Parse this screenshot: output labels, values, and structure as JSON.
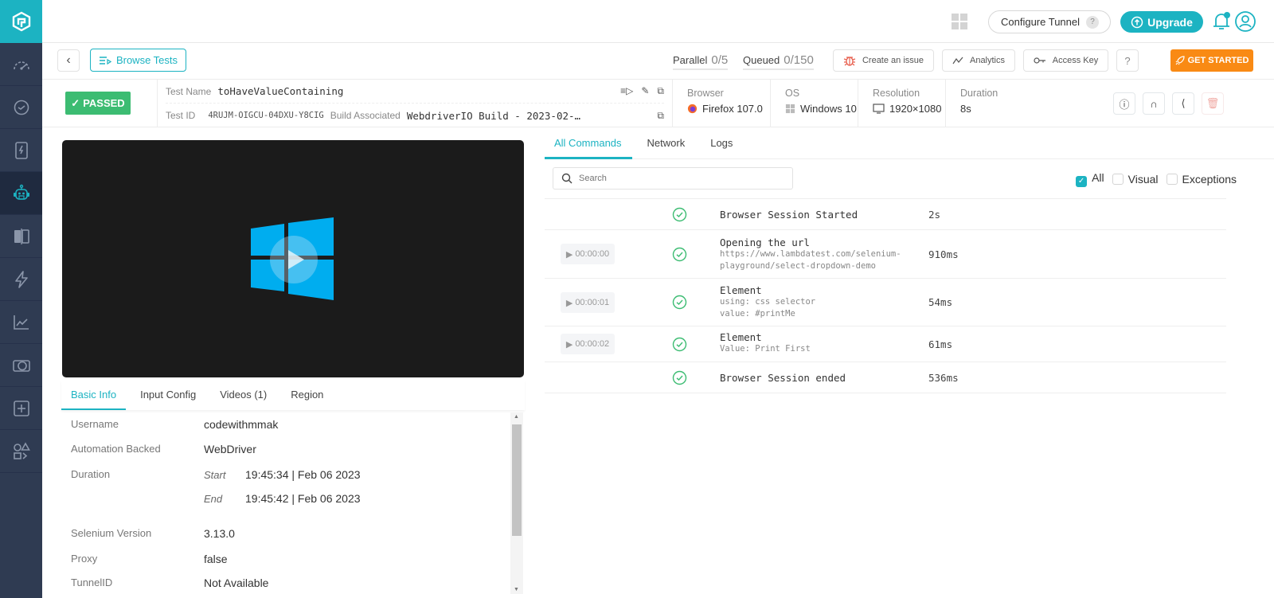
{
  "sidebar": {
    "items": [
      {
        "name": "dashboard",
        "active": false
      },
      {
        "name": "realtime-testing",
        "active": false
      },
      {
        "name": "app-testing",
        "active": false
      },
      {
        "name": "automation",
        "active": true
      },
      {
        "name": "visual-testing",
        "active": false
      },
      {
        "name": "hyperexecute",
        "active": false
      },
      {
        "name": "analytics",
        "active": false
      },
      {
        "name": "test-manager",
        "active": false
      },
      {
        "name": "add-integration",
        "active": false
      },
      {
        "name": "more-apps",
        "active": false
      }
    ]
  },
  "topbar": {
    "configure_tunnel": "Configure Tunnel",
    "help_badge": "?",
    "upgrade": "Upgrade"
  },
  "subbar": {
    "browse_tests": "Browse Tests",
    "parallel_label": "Parallel",
    "parallel_value": "0/5",
    "queued_label": "Queued",
    "queued_value": "0/150",
    "create_issue": "Create an issue",
    "analytics": "Analytics",
    "access_key": "Access Key",
    "help": "?",
    "get_started": "GET STARTED"
  },
  "test": {
    "status": "PASSED",
    "name_label": "Test Name",
    "name": "toHaveValueContaining",
    "id_label": "Test ID",
    "id": "4RUJM-OIGCU-04DXU-Y8CIG",
    "build_label": "Build Associated",
    "build": "WebdriverIO Build - 2023-02-…",
    "browser_label": "Browser",
    "browser": "Firefox 107.0",
    "os_label": "OS",
    "os": "Windows 10",
    "resolution_label": "Resolution",
    "resolution": "1920×1080",
    "duration_label": "Duration",
    "duration": "8s"
  },
  "info_tabs": [
    {
      "label": "Basic Info",
      "active": true
    },
    {
      "label": "Input Config",
      "active": false
    },
    {
      "label": "Videos (1)",
      "active": false
    },
    {
      "label": "Region",
      "active": false
    }
  ],
  "basic_info": {
    "username_label": "Username",
    "username": "codewithmmak",
    "automation_label": "Automation Backed",
    "automation": "WebDriver",
    "duration_label": "Duration",
    "start_label": "Start",
    "start_time": "19:45:34",
    "start_date": "Feb 06 2023",
    "end_label": "End",
    "end_time": "19:45:42",
    "end_date": "Feb 06 2023",
    "selenium_label": "Selenium Version",
    "selenium": "3.13.0",
    "proxy_label": "Proxy",
    "proxy": "false",
    "tunnel_label": "TunnelID",
    "tunnel": "Not Available"
  },
  "command_tabs": [
    {
      "label": "All Commands",
      "active": true
    },
    {
      "label": "Network",
      "active": false
    },
    {
      "label": "Logs",
      "active": false
    }
  ],
  "search": {
    "placeholder": "Search"
  },
  "filters": [
    {
      "label": "All",
      "checked": true
    },
    {
      "label": "Visual",
      "checked": false
    },
    {
      "label": "Exceptions",
      "checked": false
    }
  ],
  "commands": [
    {
      "timestamp": "",
      "name": "Browser Session Started",
      "details": [],
      "duration": "2s"
    },
    {
      "timestamp": "00:00:00",
      "name": "Opening the url",
      "details": [
        "https://www.lambdatest.com/selenium-",
        "playground/select-dropdown-demo"
      ],
      "duration": "910ms"
    },
    {
      "timestamp": "00:00:01",
      "name": "Element",
      "details": [
        "using: css selector",
        "value: #printMe"
      ],
      "duration": "54ms"
    },
    {
      "timestamp": "00:00:02",
      "name": "Element",
      "details": [
        "Value: Print First"
      ],
      "duration": "61ms"
    },
    {
      "timestamp": "",
      "name": "Browser Session ended",
      "details": [],
      "duration": "536ms"
    }
  ],
  "colors": {
    "brand": "#1cb3c2",
    "sidebar": "#2f3b52",
    "passed": "#3cbc72",
    "get_started": "#f98a14",
    "success_icon": "#3cbc72"
  }
}
